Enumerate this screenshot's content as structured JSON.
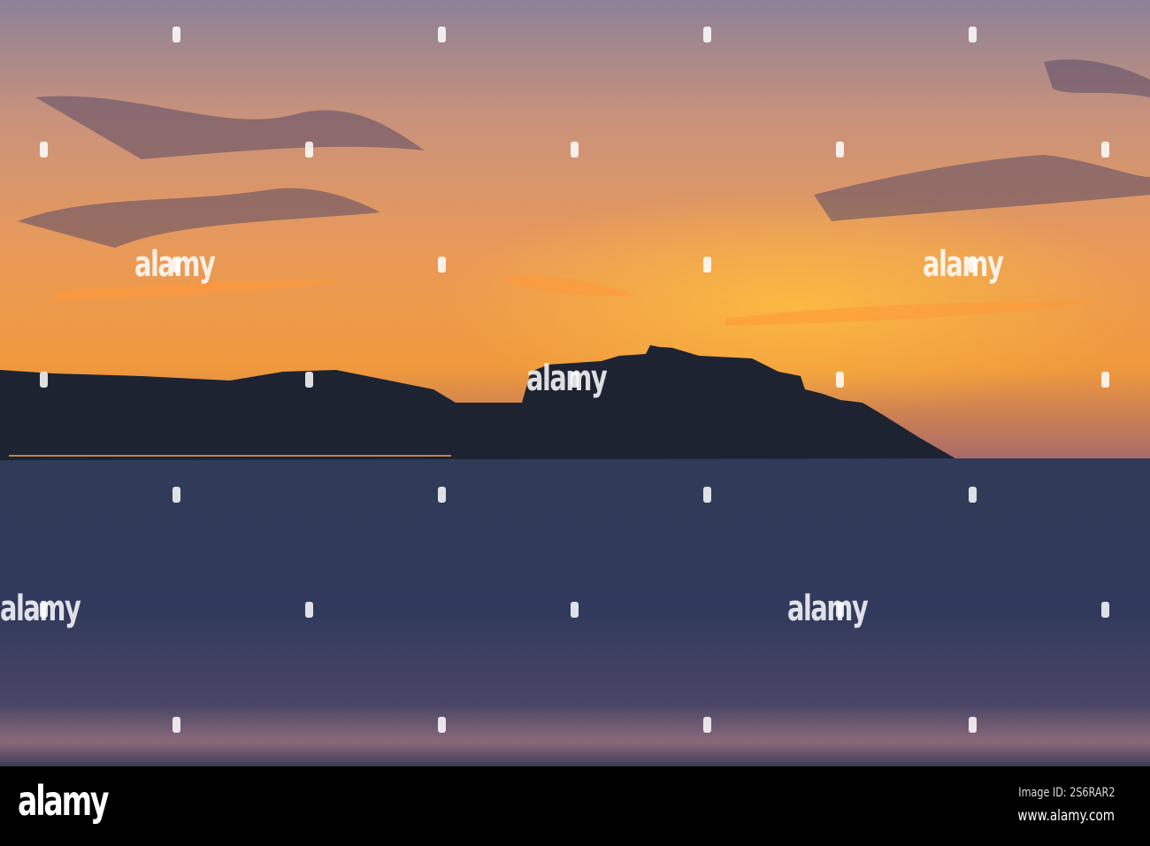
{
  "photo": {
    "subject": "sunset over sea with silhouetted hilltop citadel",
    "colors": {
      "sky_top": "#8c8198",
      "sky_mid": "#e79a5e",
      "horizon": "#f4a23c",
      "sea": "#2b3652",
      "land": "#1d2330"
    }
  },
  "watermark": "alamy",
  "footer": {
    "logo": "alamy",
    "image_id": "Image ID: 2S6RAR2",
    "url": "www.alamy.com"
  }
}
